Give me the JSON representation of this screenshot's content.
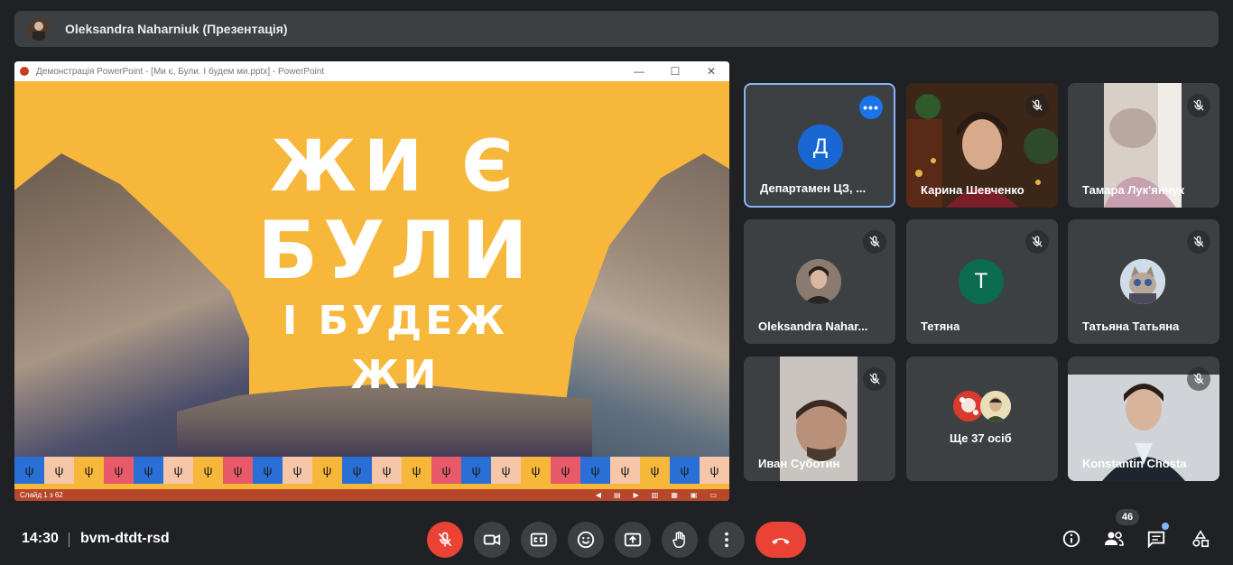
{
  "presenter": {
    "title": "Oleksandra Naharniuk (Презентація)"
  },
  "presentation": {
    "window_title": "Демонстрація PowerPoint - [Ми є, Були. І будем ми.pptx] - PowerPoint",
    "slide_line1": "ЖИ Є",
    "slide_line2": "БУЛИ",
    "slide_line3": "І БУДЕЖ ЖИ",
    "status": "Слайд 1 з 62",
    "flag_cells": [
      {
        "color": "#2a6fd6"
      },
      {
        "color": "#f6c6a8"
      },
      {
        "color": "#f6b73b"
      },
      {
        "color": "#e85a6a"
      },
      {
        "color": "#2a6fd6"
      },
      {
        "color": "#f6c6a8"
      },
      {
        "color": "#f6b73b"
      },
      {
        "color": "#e85a6a"
      },
      {
        "color": "#2a6fd6"
      },
      {
        "color": "#f6c6a8"
      },
      {
        "color": "#f6b73b"
      },
      {
        "color": "#2a6fd6"
      },
      {
        "color": "#f6c6a8"
      },
      {
        "color": "#f6b73b"
      },
      {
        "color": "#e85a6a"
      },
      {
        "color": "#2a6fd6"
      },
      {
        "color": "#f6c6a8"
      },
      {
        "color": "#f6b73b"
      },
      {
        "color": "#e85a6a"
      },
      {
        "color": "#2a6fd6"
      },
      {
        "color": "#f6c6a8"
      },
      {
        "color": "#f6b73b"
      },
      {
        "color": "#2a6fd6"
      },
      {
        "color": "#f6c6a8"
      }
    ],
    "trident_glyph": "ψ"
  },
  "participants": [
    {
      "name": "Департамен ЦЗ, ...",
      "avatar_letter": "Д",
      "avatar_color": "#1967d2",
      "active": true
    },
    {
      "name": "Карина Шевченко",
      "muted": true
    },
    {
      "name": "Тамара Лук'янчук",
      "muted": true
    },
    {
      "name": "Oleksandra Nahar...",
      "muted": true
    },
    {
      "name": "Тетяна",
      "avatar_letter": "Т",
      "avatar_color": "#0b6b4f",
      "muted": true
    },
    {
      "name": "Татьяна Татьяна",
      "muted": true
    },
    {
      "name": "Иван Суботин",
      "muted": true
    },
    {
      "name": "Ще 37 осіб"
    },
    {
      "name": "Konstantin Chosta",
      "muted": true
    }
  ],
  "more_options_glyph": "•••",
  "meeting": {
    "time": "14:30",
    "code": "bvm-dtdt-rsd",
    "participant_count": "46"
  },
  "colors": {
    "background": "#202124",
    "tile": "#3c4043",
    "accent": "#8ab4f8",
    "danger": "#ea4335",
    "slide_bg": "#f6b73b"
  }
}
